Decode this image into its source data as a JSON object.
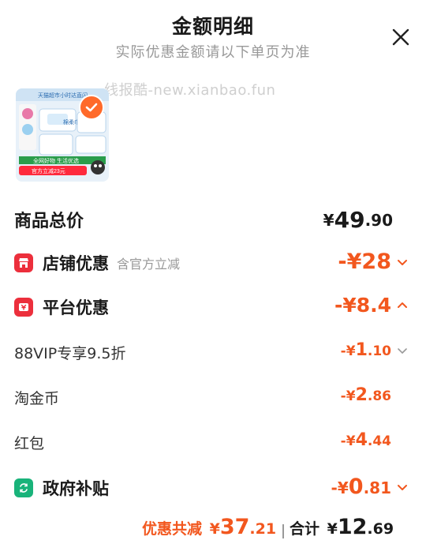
{
  "header": {
    "title": "金额明细",
    "subtitle": "实际优惠金额请以下单页为准",
    "close_icon": "close-icon"
  },
  "watermark": "线报酷-new.xianbao.fun",
  "product": {
    "thumbnail_icon": "product-thumbnail",
    "selected": true,
    "thumb_texts": {
      "banner": "天猫超市小时达直闪",
      "brand": "棉柔巾",
      "slogan": "全网好物 生活优选",
      "tag": "官方立减23元"
    }
  },
  "rows": {
    "total": {
      "label": "商品总价",
      "currency": "¥",
      "int": "49",
      "dec": ".90"
    },
    "shop": {
      "label": "店铺优惠",
      "note": "含官方立减",
      "value": "-¥28",
      "icon": "shop-icon",
      "color": "#ec2f3c"
    },
    "platform": {
      "label": "平台优惠",
      "value": "-¥8.4",
      "icon": "coupon-icon",
      "color": "#ec2f3c"
    },
    "vip": {
      "label": "88VIP专享9.5折",
      "sign": "-¥",
      "int": "1",
      "dec": ".10"
    },
    "coin": {
      "label": "淘金币",
      "sign": "-¥",
      "int": "2",
      "dec": ".86"
    },
    "redpacket": {
      "label": "红包",
      "sign": "-¥",
      "int": "4",
      "dec": ".44"
    },
    "gov": {
      "label": "政府补贴",
      "sign": "-¥",
      "int": "0",
      "dec": ".81",
      "icon": "refresh-icon",
      "color": "#19b37a"
    }
  },
  "footer": {
    "discount_label": "优惠共减",
    "discount_currency": "¥",
    "discount_int": "37",
    "discount_dec": ".21",
    "total_label": "合计",
    "total_currency": "¥",
    "total_int": "12",
    "total_dec": ".69"
  },
  "colors": {
    "accent": "#f2571e",
    "text": "#1a1a1a",
    "muted": "#999999"
  }
}
